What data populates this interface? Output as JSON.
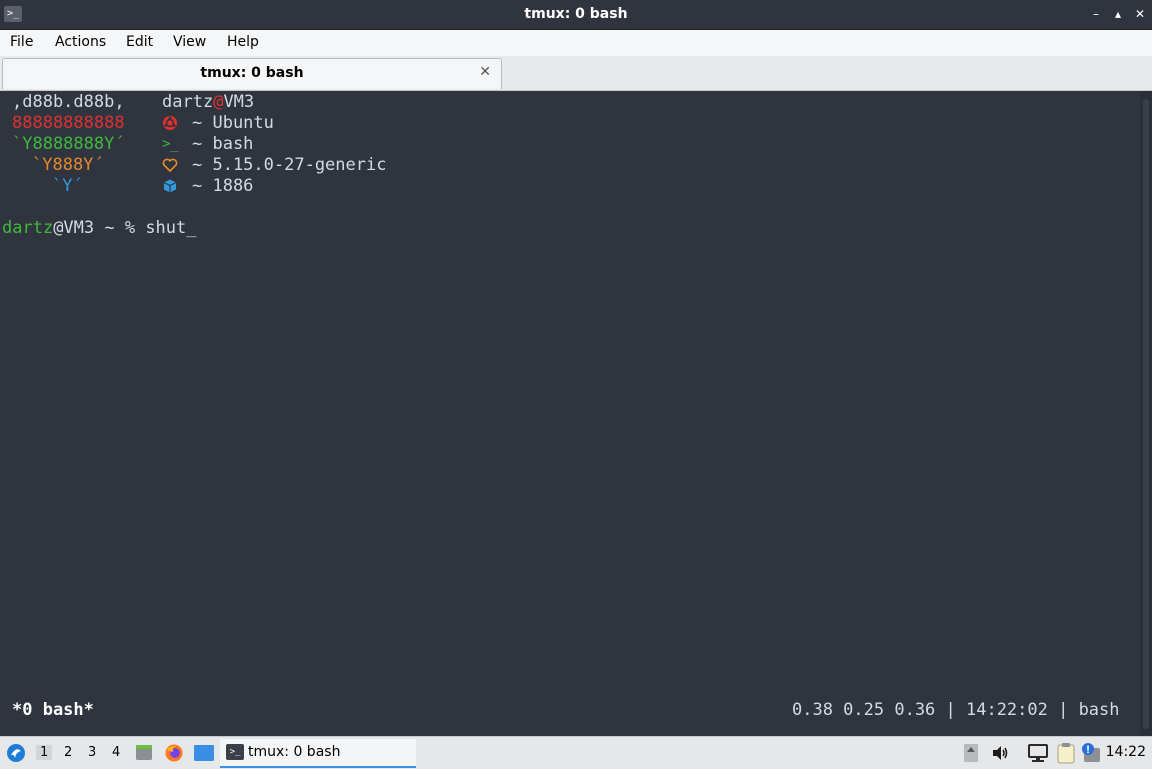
{
  "window": {
    "app_icon": ">_",
    "title": "tmux: 0 bash",
    "minimize": "–",
    "maximize": "▴",
    "close": "✕"
  },
  "menu": {
    "file": "File",
    "actions": "Actions",
    "edit": "Edit",
    "view": "View",
    "help": "Help"
  },
  "tab": {
    "label": "tmux: 0 bash",
    "close": "✕"
  },
  "terminal": {
    "art": [
      ",d88b.d88b,",
      "88888888888",
      "`Y8888888Y´",
      "`Y888Y´",
      "`Y´"
    ],
    "user_host": {
      "user": "dartz",
      "at": "@",
      "host": "VM3"
    },
    "info": [
      {
        "icon": "ubuntu-icon",
        "text": "~ Ubuntu"
      },
      {
        "icon": "terminal-icon",
        "glyph": ">_",
        "text": "~ bash"
      },
      {
        "icon": "heart-icon",
        "text": "~ 5.15.0-27-generic"
      },
      {
        "icon": "package-icon",
        "text": "~ 1886"
      }
    ],
    "prompt": {
      "user": "dartz",
      "rest": "@VM3 ~ % ",
      "command": "shut_"
    },
    "status_left": "*0 bash*",
    "status_right": "0.38 0.25 0.36 | 14:22:02 | bash"
  },
  "taskbar": {
    "workspaces": [
      "1",
      "2",
      "3",
      "4"
    ],
    "active_workspace": "1",
    "task_label": "tmux: 0 bash",
    "task_icon": ">_",
    "clock": "14:22"
  },
  "colors": {
    "background": "#2f343f",
    "red": "#e0312f",
    "green": "#3fb93b",
    "orange": "#e48a2b",
    "blue": "#3399dd",
    "accent": "#3a8ee6"
  }
}
